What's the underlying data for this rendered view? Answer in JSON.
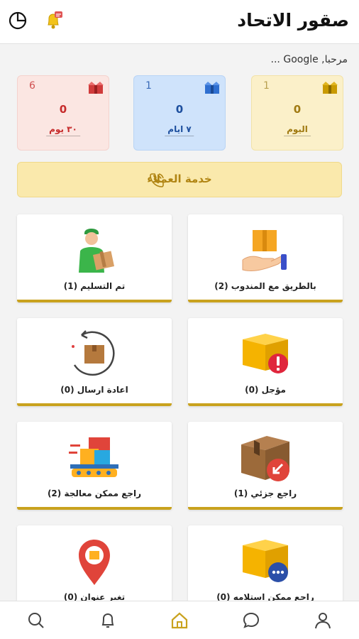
{
  "header": {
    "title": "صقور الاتحاد",
    "pie_icon": "pie-chart-icon",
    "bell_icon": "notification-bell-icon",
    "bell_badge_color": "#e05555"
  },
  "greeting": "مرحبا, Google ...",
  "stats": [
    {
      "count": "1",
      "value": "0",
      "label": "اليوم",
      "color": "#a07a12",
      "icon": "box-icon"
    },
    {
      "count": "1",
      "value": "0",
      "label": "٧ ايام",
      "color": "#1d4f9e",
      "icon": "box-icon"
    },
    {
      "count": "6",
      "value": "0",
      "label": "٣٠ يوم",
      "color": "#c62b2b",
      "icon": "box-icon"
    }
  ],
  "customer_service": {
    "label": "خدمة العملاء",
    "icon": "phone-icon",
    "color": "#b08412"
  },
  "cards": [
    {
      "label": "بالطريق مع المندوب (2)",
      "icon": "hand-box-icon"
    },
    {
      "label": "تم التسليم (1)",
      "icon": "delivery-man-icon"
    },
    {
      "label": "مؤجل (0)",
      "icon": "postponed-box-icon"
    },
    {
      "label": "اعادة ارسال (0)",
      "icon": "resend-box-icon"
    },
    {
      "label": "راجع جزئي (1)",
      "icon": "partial-return-icon"
    },
    {
      "label": "راجع ممكن معالجة (2)",
      "icon": "conveyor-icon"
    },
    {
      "label": "راجع ممكن استلامه (0)",
      "icon": "box-chat-icon"
    },
    {
      "label": "تغير عنوان (0)",
      "icon": "location-pin-icon"
    }
  ],
  "nav": [
    {
      "name": "search",
      "icon": "search-icon"
    },
    {
      "name": "notifications",
      "icon": "bell-icon"
    },
    {
      "name": "home",
      "icon": "home-icon",
      "active": true
    },
    {
      "name": "chat",
      "icon": "chat-icon"
    },
    {
      "name": "profile",
      "icon": "user-icon"
    }
  ],
  "accent_color": "#c9a21e"
}
